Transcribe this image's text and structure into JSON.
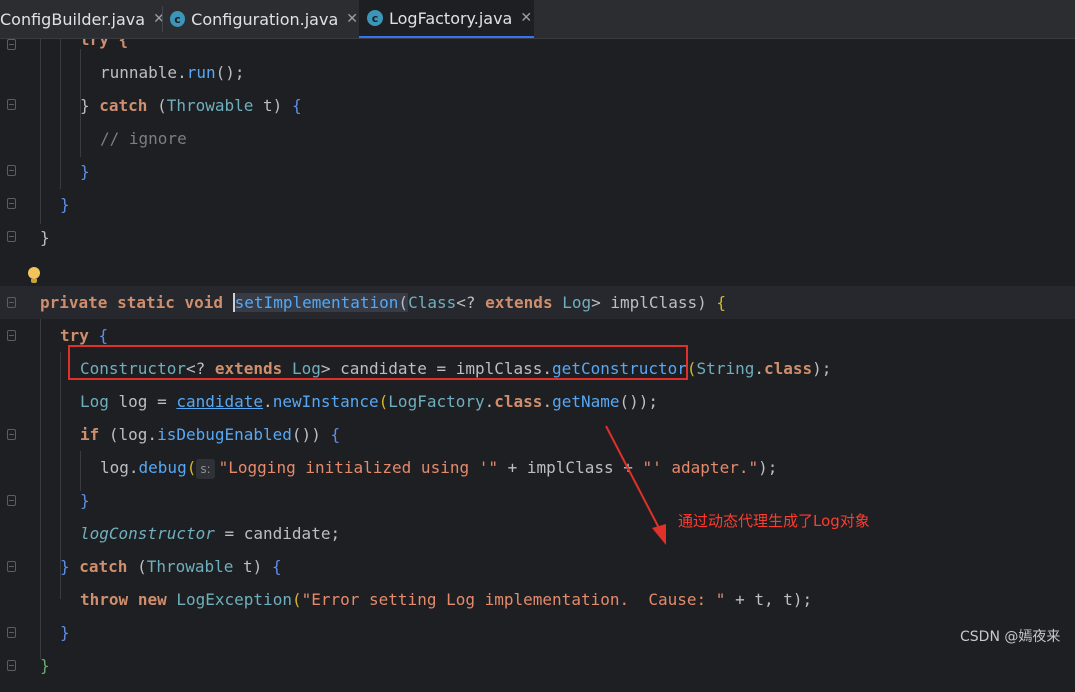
{
  "tabs": [
    {
      "label": "ConfigBuilder.java",
      "close": "✕",
      "active": false
    },
    {
      "label": "Configuration.java",
      "close": "✕",
      "active": false
    },
    {
      "label": "LogFactory.java",
      "close": "✕",
      "active": true
    }
  ],
  "code": {
    "l0": "try {",
    "l1_a": "runnable",
    "l1_b": ".",
    "l1_c": "run",
    "l1_d": "();",
    "l2_a": "} ",
    "l2_b": "catch",
    "l2_c": " (",
    "l2_d": "Throwable",
    "l2_e": " t) ",
    "l2_f": "{",
    "l3": "// ignore",
    "l4": "}",
    "l5": "}",
    "l6": "}",
    "l8_a": "private static void ",
    "l8_b": "setImplementation",
    "l8_c": "(",
    "l8_d": "Class",
    "l8_e": "<? ",
    "l8_f": "extends",
    "l8_g": " ",
    "l8_h": "Log",
    "l8_i": "> implClass) ",
    "l8_j": "{",
    "l9_a": "try",
    "l9_b": " {",
    "l10_a": "Constructor",
    "l10_b": "<? ",
    "l10_c": "extends",
    "l10_d": " ",
    "l10_e": "Log",
    "l10_f": "> candidate = implClass.",
    "l10_g": "getConstructor",
    "l10_h": "(",
    "l10_i": "String",
    "l10_j": ".",
    "l10_k": "class",
    "l10_l": ");",
    "l11_a": "Log",
    "l11_b": " log = ",
    "l11_c": "candidate",
    "l11_d": ".",
    "l11_e": "newInstance",
    "l11_f": "(",
    "l11_g": "LogFactory",
    "l11_h": ".",
    "l11_i": "class",
    "l11_j": ".",
    "l11_k": "getName",
    "l11_l": "());",
    "l12_a": "if",
    "l12_b": " (log.",
    "l12_c": "isDebugEnabled",
    "l12_d": "()) ",
    "l12_e": "{",
    "l13_a": "log.",
    "l13_b": "debug",
    "l13_c": "(",
    "l13_hint": "s:",
    "l13_d": "\"Logging initialized using '\"",
    "l13_e": " + implClass + ",
    "l13_f": "\"' adapter.\"",
    "l13_g": ");",
    "l14": "}",
    "l15_a": "logConstructor",
    "l15_b": " = candidate;",
    "l16_a": "} ",
    "l16_b": "catch",
    "l16_c": " (",
    "l16_d": "Throwable",
    "l16_e": " t) ",
    "l16_f": "{",
    "l17_a": "throw",
    "l17_b": " ",
    "l17_c": "new",
    "l17_d": " ",
    "l17_e": "LogException",
    "l17_f": "(",
    "l17_g": "\"Error setting Log implementation.  Cause: \"",
    "l17_h": " + t, t);",
    "l18": "}",
    "l19": "}"
  },
  "annotation": "通过动态代理生成了Log对象",
  "watermark": "CSDN @嫣夜来",
  "colors": {
    "highlight_box": "#e0302a",
    "annotation_text": "#ff3b30",
    "active_tab_underline": "#3574f0"
  }
}
